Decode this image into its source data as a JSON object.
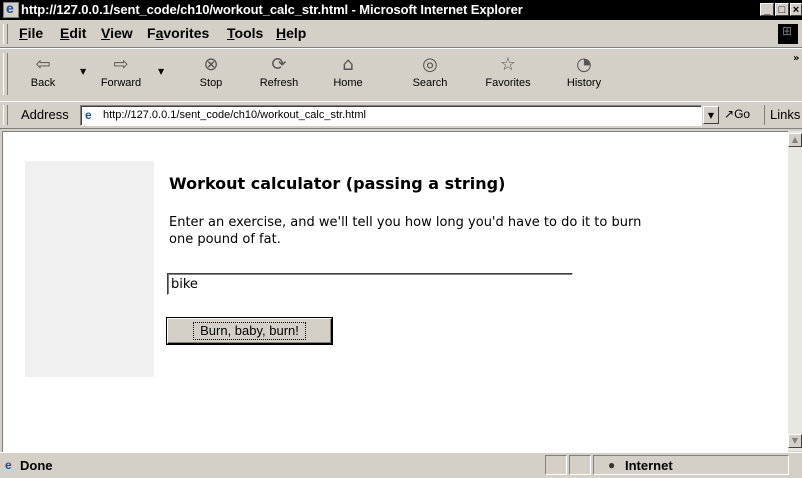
{
  "window": {
    "title": "http://127.0.0.1/sent_code/ch10/workout_calc_str.html - Microsoft Internet Explorer",
    "controls": [
      "_",
      "□",
      "×"
    ]
  },
  "menu": {
    "items": [
      {
        "label": "File",
        "accel": "F"
      },
      {
        "label": "Edit",
        "accel": "E"
      },
      {
        "label": "View",
        "accel": "V"
      },
      {
        "label": "Favorites",
        "accel": "a"
      },
      {
        "label": "Tools",
        "accel": "T"
      },
      {
        "label": "Help",
        "accel": "H"
      }
    ]
  },
  "toolbar": {
    "back": "Back",
    "forward": "Forward",
    "stop": "Stop",
    "refresh": "Refresh",
    "home": "Home",
    "search": "Search",
    "favorites": "Favorites",
    "history": "History"
  },
  "address": {
    "label": "Address",
    "url": "http://127.0.0.1/sent_code/ch10/workout_calc_str.html",
    "go": "Go",
    "links": "Links"
  },
  "page": {
    "title": "Workout calculator (passing a string)",
    "description": "Enter an exercise, and we'll tell you how long you'd have to do it to burn one pound of fat.",
    "input_value": "bike",
    "button_label": "Burn, baby, burn!"
  },
  "status": {
    "text": "Done",
    "zone": "Internet"
  }
}
